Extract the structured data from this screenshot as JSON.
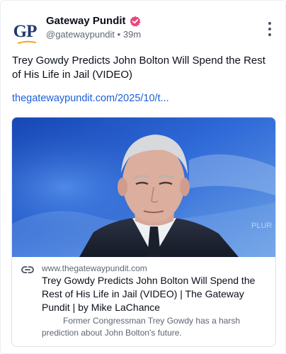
{
  "account": {
    "display_name": "Gateway Pundit",
    "handle": "@gatewaypundit",
    "separator": "•",
    "time": "39m",
    "avatar_text": "GP"
  },
  "post": {
    "text": "Trey Gowdy Predicts John Bolton Will Spend the Rest of His Life in Jail (VIDEO)",
    "link_text": "thegatewaypundit.com/2025/10/t..."
  },
  "card": {
    "thumb_overlay_text": "PLUR",
    "domain": "www.thegatewaypundit.com",
    "title": "Trey Gowdy Predicts John Bolton Will Spend the Rest of His Life in Jail (VIDEO) | The Gateway Pundit | by Mike LaChance",
    "description": "Former Congressman Trey Gowdy has a harsh prediction about John Bolton's future."
  },
  "icons": [
    "verified-badge-icon",
    "more-vertical-icon",
    "link-icon"
  ],
  "colors": {
    "link": "#1d5fd6",
    "verified": "#e8457a",
    "logo": "#1f3b6e",
    "logo_swoosh": "#f2a51a"
  }
}
